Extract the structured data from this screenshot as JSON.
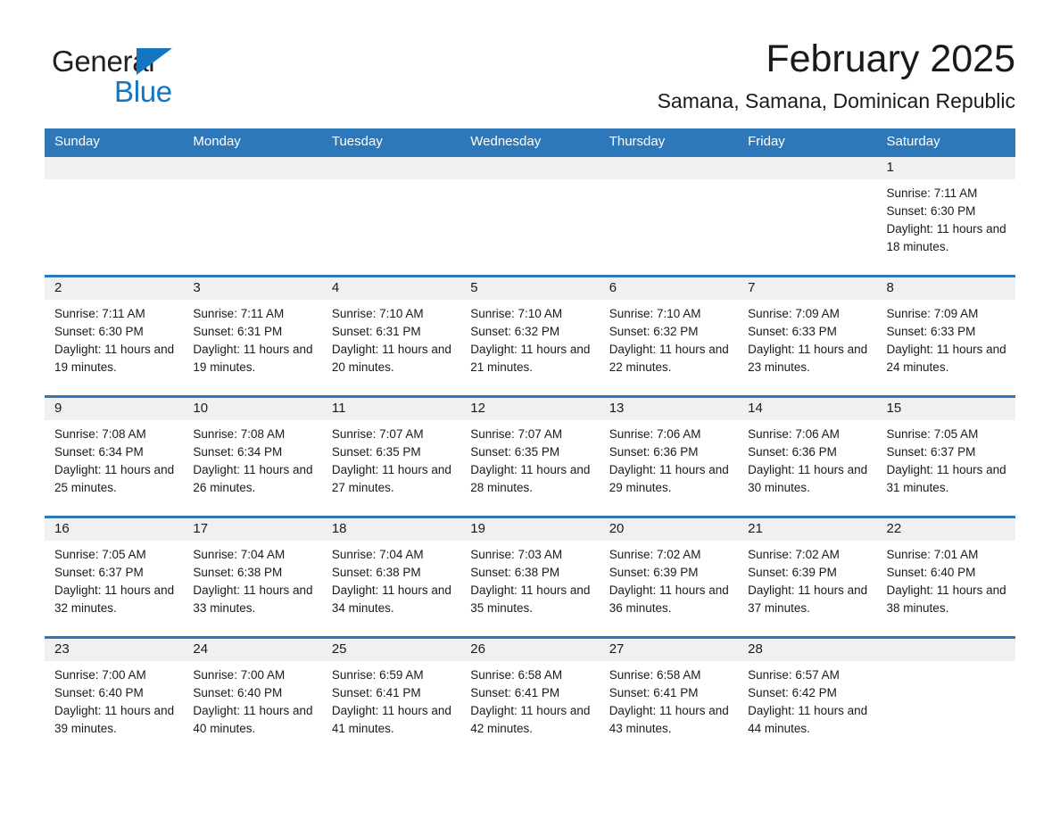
{
  "brand": {
    "name_part1": "General",
    "name_part2": "Blue",
    "accent_color": "#1476c0"
  },
  "header": {
    "title": "February 2025",
    "location": "Samana, Samana, Dominican Republic"
  },
  "calendar": {
    "header_bg": "#2e77b8",
    "daynum_bg": "#f0f0f0",
    "weekday_headers": [
      "Sunday",
      "Monday",
      "Tuesday",
      "Wednesday",
      "Thursday",
      "Friday",
      "Saturday"
    ],
    "weeks": [
      [
        {
          "day": "",
          "sunrise": "",
          "sunset": "",
          "daylight": "",
          "empty": true
        },
        {
          "day": "",
          "sunrise": "",
          "sunset": "",
          "daylight": "",
          "empty": true
        },
        {
          "day": "",
          "sunrise": "",
          "sunset": "",
          "daylight": "",
          "empty": true
        },
        {
          "day": "",
          "sunrise": "",
          "sunset": "",
          "daylight": "",
          "empty": true
        },
        {
          "day": "",
          "sunrise": "",
          "sunset": "",
          "daylight": "",
          "empty": true
        },
        {
          "day": "",
          "sunrise": "",
          "sunset": "",
          "daylight": "",
          "empty": true
        },
        {
          "day": "1",
          "sunrise": "Sunrise: 7:11 AM",
          "sunset": "Sunset: 6:30 PM",
          "daylight": "Daylight: 11 hours and 18 minutes.",
          "empty": false
        }
      ],
      [
        {
          "day": "2",
          "sunrise": "Sunrise: 7:11 AM",
          "sunset": "Sunset: 6:30 PM",
          "daylight": "Daylight: 11 hours and 19 minutes.",
          "empty": false
        },
        {
          "day": "3",
          "sunrise": "Sunrise: 7:11 AM",
          "sunset": "Sunset: 6:31 PM",
          "daylight": "Daylight: 11 hours and 19 minutes.",
          "empty": false
        },
        {
          "day": "4",
          "sunrise": "Sunrise: 7:10 AM",
          "sunset": "Sunset: 6:31 PM",
          "daylight": "Daylight: 11 hours and 20 minutes.",
          "empty": false
        },
        {
          "day": "5",
          "sunrise": "Sunrise: 7:10 AM",
          "sunset": "Sunset: 6:32 PM",
          "daylight": "Daylight: 11 hours and 21 minutes.",
          "empty": false
        },
        {
          "day": "6",
          "sunrise": "Sunrise: 7:10 AM",
          "sunset": "Sunset: 6:32 PM",
          "daylight": "Daylight: 11 hours and 22 minutes.",
          "empty": false
        },
        {
          "day": "7",
          "sunrise": "Sunrise: 7:09 AM",
          "sunset": "Sunset: 6:33 PM",
          "daylight": "Daylight: 11 hours and 23 minutes.",
          "empty": false
        },
        {
          "day": "8",
          "sunrise": "Sunrise: 7:09 AM",
          "sunset": "Sunset: 6:33 PM",
          "daylight": "Daylight: 11 hours and 24 minutes.",
          "empty": false
        }
      ],
      [
        {
          "day": "9",
          "sunrise": "Sunrise: 7:08 AM",
          "sunset": "Sunset: 6:34 PM",
          "daylight": "Daylight: 11 hours and 25 minutes.",
          "empty": false
        },
        {
          "day": "10",
          "sunrise": "Sunrise: 7:08 AM",
          "sunset": "Sunset: 6:34 PM",
          "daylight": "Daylight: 11 hours and 26 minutes.",
          "empty": false
        },
        {
          "day": "11",
          "sunrise": "Sunrise: 7:07 AM",
          "sunset": "Sunset: 6:35 PM",
          "daylight": "Daylight: 11 hours and 27 minutes.",
          "empty": false
        },
        {
          "day": "12",
          "sunrise": "Sunrise: 7:07 AM",
          "sunset": "Sunset: 6:35 PM",
          "daylight": "Daylight: 11 hours and 28 minutes.",
          "empty": false
        },
        {
          "day": "13",
          "sunrise": "Sunrise: 7:06 AM",
          "sunset": "Sunset: 6:36 PM",
          "daylight": "Daylight: 11 hours and 29 minutes.",
          "empty": false
        },
        {
          "day": "14",
          "sunrise": "Sunrise: 7:06 AM",
          "sunset": "Sunset: 6:36 PM",
          "daylight": "Daylight: 11 hours and 30 minutes.",
          "empty": false
        },
        {
          "day": "15",
          "sunrise": "Sunrise: 7:05 AM",
          "sunset": "Sunset: 6:37 PM",
          "daylight": "Daylight: 11 hours and 31 minutes.",
          "empty": false
        }
      ],
      [
        {
          "day": "16",
          "sunrise": "Sunrise: 7:05 AM",
          "sunset": "Sunset: 6:37 PM",
          "daylight": "Daylight: 11 hours and 32 minutes.",
          "empty": false
        },
        {
          "day": "17",
          "sunrise": "Sunrise: 7:04 AM",
          "sunset": "Sunset: 6:38 PM",
          "daylight": "Daylight: 11 hours and 33 minutes.",
          "empty": false
        },
        {
          "day": "18",
          "sunrise": "Sunrise: 7:04 AM",
          "sunset": "Sunset: 6:38 PM",
          "daylight": "Daylight: 11 hours and 34 minutes.",
          "empty": false
        },
        {
          "day": "19",
          "sunrise": "Sunrise: 7:03 AM",
          "sunset": "Sunset: 6:38 PM",
          "daylight": "Daylight: 11 hours and 35 minutes.",
          "empty": false
        },
        {
          "day": "20",
          "sunrise": "Sunrise: 7:02 AM",
          "sunset": "Sunset: 6:39 PM",
          "daylight": "Daylight: 11 hours and 36 minutes.",
          "empty": false
        },
        {
          "day": "21",
          "sunrise": "Sunrise: 7:02 AM",
          "sunset": "Sunset: 6:39 PM",
          "daylight": "Daylight: 11 hours and 37 minutes.",
          "empty": false
        },
        {
          "day": "22",
          "sunrise": "Sunrise: 7:01 AM",
          "sunset": "Sunset: 6:40 PM",
          "daylight": "Daylight: 11 hours and 38 minutes.",
          "empty": false
        }
      ],
      [
        {
          "day": "23",
          "sunrise": "Sunrise: 7:00 AM",
          "sunset": "Sunset: 6:40 PM",
          "daylight": "Daylight: 11 hours and 39 minutes.",
          "empty": false
        },
        {
          "day": "24",
          "sunrise": "Sunrise: 7:00 AM",
          "sunset": "Sunset: 6:40 PM",
          "daylight": "Daylight: 11 hours and 40 minutes.",
          "empty": false
        },
        {
          "day": "25",
          "sunrise": "Sunrise: 6:59 AM",
          "sunset": "Sunset: 6:41 PM",
          "daylight": "Daylight: 11 hours and 41 minutes.",
          "empty": false
        },
        {
          "day": "26",
          "sunrise": "Sunrise: 6:58 AM",
          "sunset": "Sunset: 6:41 PM",
          "daylight": "Daylight: 11 hours and 42 minutes.",
          "empty": false
        },
        {
          "day": "27",
          "sunrise": "Sunrise: 6:58 AM",
          "sunset": "Sunset: 6:41 PM",
          "daylight": "Daylight: 11 hours and 43 minutes.",
          "empty": false
        },
        {
          "day": "28",
          "sunrise": "Sunrise: 6:57 AM",
          "sunset": "Sunset: 6:42 PM",
          "daylight": "Daylight: 11 hours and 44 minutes.",
          "empty": false
        },
        {
          "day": "",
          "sunrise": "",
          "sunset": "",
          "daylight": "",
          "empty": true
        }
      ]
    ]
  }
}
